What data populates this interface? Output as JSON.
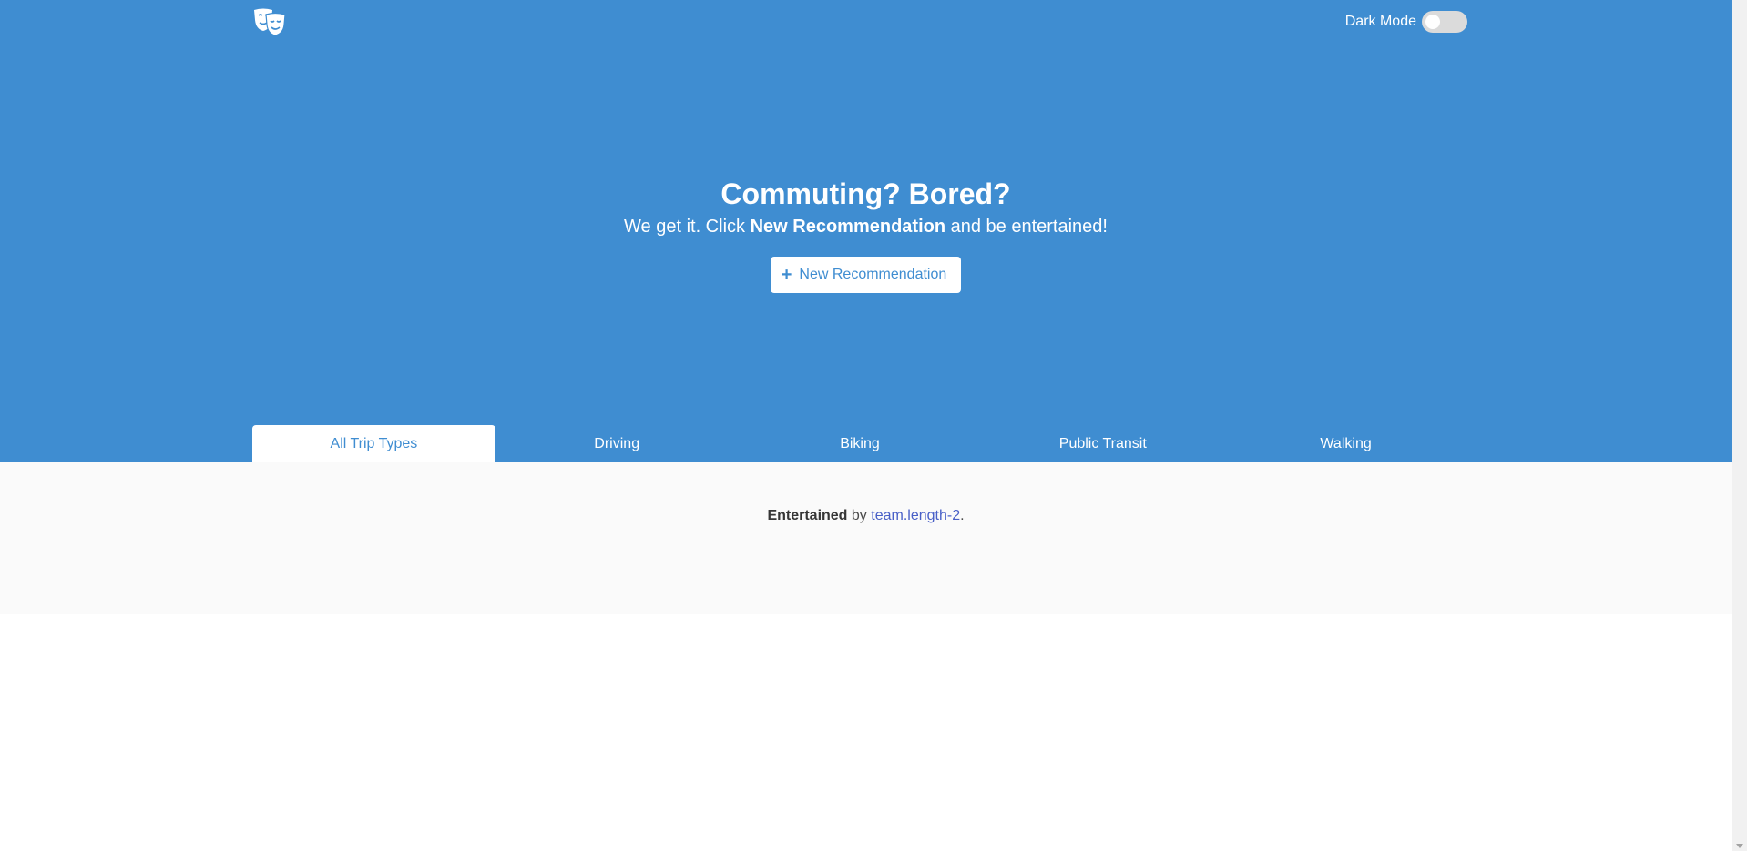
{
  "navbar": {
    "logo_icon": "theater-masks-icon",
    "dark_mode_label": "Dark Mode",
    "dark_mode_enabled": false
  },
  "hero": {
    "title": "Commuting? Bored?",
    "subtitle_before": "We get it. Click ",
    "subtitle_strong": "New Recommendation",
    "subtitle_after": " and be entertained!",
    "button_label": "New Recommendation",
    "button_icon": "plus-icon"
  },
  "tabs": [
    {
      "label": "All Trip Types",
      "active": true
    },
    {
      "label": "Driving",
      "active": false
    },
    {
      "label": "Biking",
      "active": false
    },
    {
      "label": "Public Transit",
      "active": false
    },
    {
      "label": "Walking",
      "active": false
    }
  ],
  "footer": {
    "strong": "Entertained",
    "by": " by ",
    "link": "team.length-2",
    "end": "."
  },
  "colors": {
    "accent": "#3f8dd1",
    "footer_bg": "#fafafa",
    "link": "#485fc7"
  }
}
